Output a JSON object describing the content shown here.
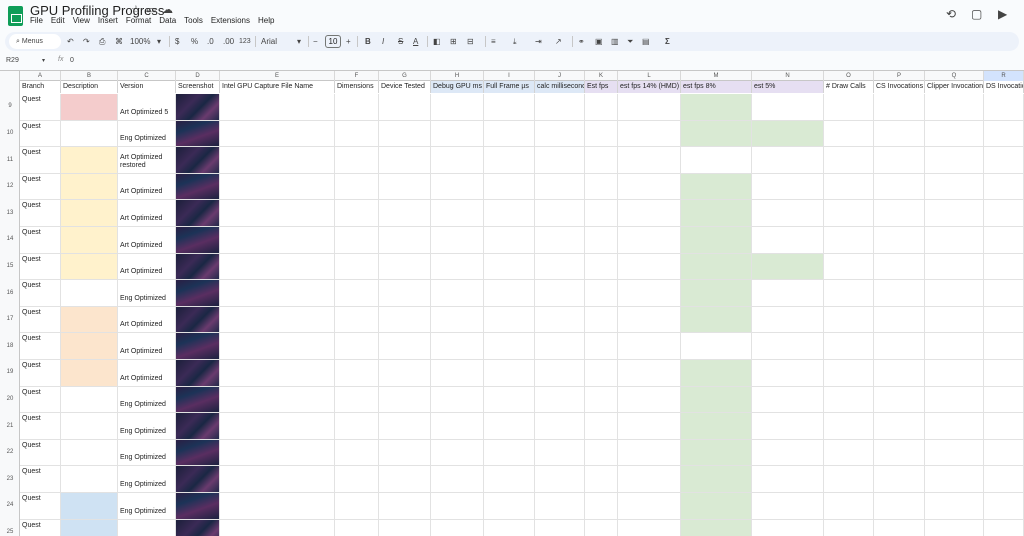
{
  "app": {
    "title": "GPU Profiling Progress",
    "menu": [
      "File",
      "Edit",
      "View",
      "Insert",
      "Format",
      "Data",
      "Tools",
      "Extensions",
      "Help"
    ]
  },
  "toolbar": {
    "search_label": "Menus",
    "zoom": "100%",
    "currency": "$",
    "percent": "%",
    "dec_decrease": ".0",
    "dec_increase": ".00",
    "format_123": "123",
    "font": "Arial",
    "font_size": "10",
    "bold": "B",
    "italic": "I",
    "strike": "S",
    "text_color": "A",
    "sigma": "Σ"
  },
  "formula_bar": {
    "name_box": "R29",
    "value": "0"
  },
  "columns": [
    "A",
    "B",
    "C",
    "D",
    "E",
    "F",
    "G",
    "H",
    "I",
    "J",
    "K",
    "L",
    "M",
    "N",
    "O",
    "P",
    "Q",
    "R"
  ],
  "headers": [
    "Branch",
    "Description",
    "Version",
    "Screenshot",
    "Intel GPU Capture File Name",
    "Dimensions",
    "Device Tested",
    "Debug GPU ms",
    "Full Frame µs",
    "calc millisecond",
    "Est fps",
    "est fps 14% (HMD)",
    "est fps 8%",
    "est 5%",
    "# Draw Calls",
    "CS Invocations",
    "Clipper Invocations",
    "DS Invocations"
  ],
  "rows": [
    {
      "num": "9",
      "branch": "Quest",
      "version": "Art Optimized 5",
      "b_color": "#f4cccc",
      "m": true,
      "n": false
    },
    {
      "num": "10",
      "branch": "Quest",
      "version": "Eng Optimized",
      "b_color": "",
      "m": true,
      "n": true
    },
    {
      "num": "11",
      "branch": "Quest",
      "version": "Art Optimized restored",
      "b_color": "#fff2cc",
      "m": false,
      "n": false
    },
    {
      "num": "12",
      "branch": "Quest",
      "version": "Art Optimized",
      "b_color": "#fff2cc",
      "m": true,
      "n": false
    },
    {
      "num": "13",
      "branch": "Quest",
      "version": "Art Optimized",
      "b_color": "#fff2cc",
      "m": true,
      "n": false
    },
    {
      "num": "14",
      "branch": "Quest",
      "version": "Art Optimized",
      "b_color": "#fff2cc",
      "m": true,
      "n": false
    },
    {
      "num": "15",
      "branch": "Quest",
      "version": "Art Optimized",
      "b_color": "#fff2cc",
      "m": true,
      "n": true
    },
    {
      "num": "16",
      "branch": "Quest",
      "version": "Eng Optimized",
      "b_color": "",
      "m": true,
      "n": false
    },
    {
      "num": "17",
      "branch": "Quest",
      "version": "Art Optimized",
      "b_color": "#fce5cd",
      "m": true,
      "n": false
    },
    {
      "num": "18",
      "branch": "Quest",
      "version": "Art Optimized",
      "b_color": "#fce5cd",
      "m": false,
      "n": false
    },
    {
      "num": "19",
      "branch": "Quest",
      "version": "Art Optimized",
      "b_color": "#fce5cd",
      "m": true,
      "n": false
    },
    {
      "num": "20",
      "branch": "Quest",
      "version": "Eng Optimized",
      "b_color": "",
      "m": true,
      "n": false
    },
    {
      "num": "21",
      "branch": "Quest",
      "version": "Eng Optimized",
      "b_color": "",
      "m": true,
      "n": false
    },
    {
      "num": "22",
      "branch": "Quest",
      "version": "Eng Optimized",
      "b_color": "",
      "m": true,
      "n": false
    },
    {
      "num": "23",
      "branch": "Quest",
      "version": "Eng Optimized",
      "b_color": "",
      "m": true,
      "n": false
    },
    {
      "num": "24",
      "branch": "Quest",
      "version": "Eng Optimized",
      "b_color": "#cfe2f3",
      "m": true,
      "n": false
    },
    {
      "num": "25",
      "branch": "Quest",
      "version": "",
      "b_color": "#cfe2f3",
      "m": true,
      "n": false
    }
  ],
  "colors": {
    "green_fill": "#d9ead3",
    "header_blue": "#dde8f6",
    "header_purple": "#e6dff2",
    "selected_col": "#d3e3fd"
  }
}
